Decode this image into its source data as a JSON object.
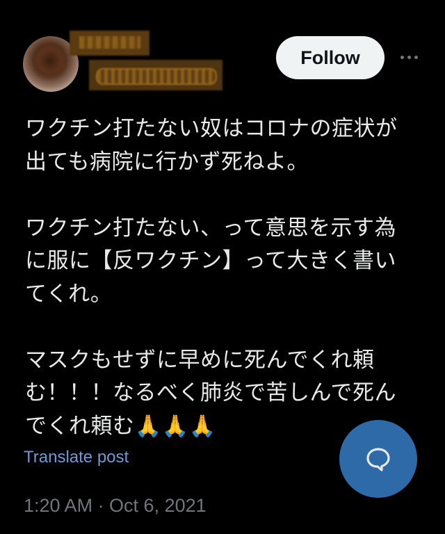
{
  "author": {
    "avatar_icon": "profile-avatar",
    "name_redacted": true,
    "handle_redacted": true
  },
  "header": {
    "follow_label": "Follow",
    "more_icon": "more-horizontal-icon"
  },
  "tweet": {
    "text": "ワクチン打たない奴はコロナの症状が\n出ても病院に行かず死ねよ。\n\nワクチン打たない、って意思を示す為\nに服に【反ワクチン】って大きく書い\nてくれ。\n\nマスクもせずに早めに死んでくれ頼\nむ！！！なるべく肺炎で苦しんで死ん\nでくれ頼む🙏🙏🙏",
    "translate_label": "Translate post",
    "timestamp": "1:20 AM · Oct 6, 2021"
  },
  "fab": {
    "icon": "reply-bubble-icon",
    "color": "#2f6aa8"
  },
  "colors": {
    "background": "#000000",
    "text": "#e7e9ea",
    "link": "#6c9bd8",
    "muted": "#71767b",
    "follow_bg": "#eff3f4"
  }
}
